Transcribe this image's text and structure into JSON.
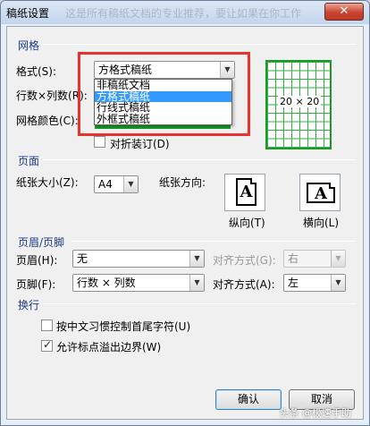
{
  "window": {
    "title": "稿纸设置",
    "background_text": "这是所有稿纸文档的专业推荐，要让如果在你工作",
    "close_label": "✕"
  },
  "grid": {
    "section_label": "网格",
    "format_label": "格式(S):",
    "format_value": "方格式稿纸",
    "format_options": [
      "非稿纸文档",
      "方格式稿纸",
      "行线式稿纸",
      "外框式稿纸"
    ],
    "format_selected_index": 1,
    "rowcol_label": "行数×列数(R):",
    "color_label": "网格颜色(C):",
    "fold_label": "对折装订(D)",
    "fold_checked": false,
    "preview_text": "20 × 20",
    "preview_color": "#1a9a2a"
  },
  "page": {
    "section_label": "页面",
    "size_label": "纸张大小(Z):",
    "size_value": "A4",
    "orientation_label": "纸张方向:",
    "portrait_label": "纵向(T)",
    "landscape_label": "横向(L)",
    "doc_glyph": "A"
  },
  "header_footer": {
    "section_label": "页眉/页脚",
    "header_label": "页眉(H):",
    "header_value": "无",
    "header_align_label": "对齐方式(G):",
    "header_align_value": "右",
    "footer_label": "页脚(F):",
    "footer_value": "行数 × 列数",
    "footer_align_label": "对齐方式(A):",
    "footer_align_value": "左"
  },
  "wrap": {
    "section_label": "换行",
    "option1_label": "按中文习惯控制首尾字符(U)",
    "option1_checked": false,
    "option2_label": "允许标点溢出边界(W)",
    "option2_checked": true
  },
  "buttons": {
    "ok_label": "确认",
    "cancel_label": "取消"
  },
  "watermark_text": "头条 @极速手助",
  "colors": {
    "highlight": "#e8322d",
    "selection": "#3399ff",
    "section_text": "#1e3b8a"
  }
}
